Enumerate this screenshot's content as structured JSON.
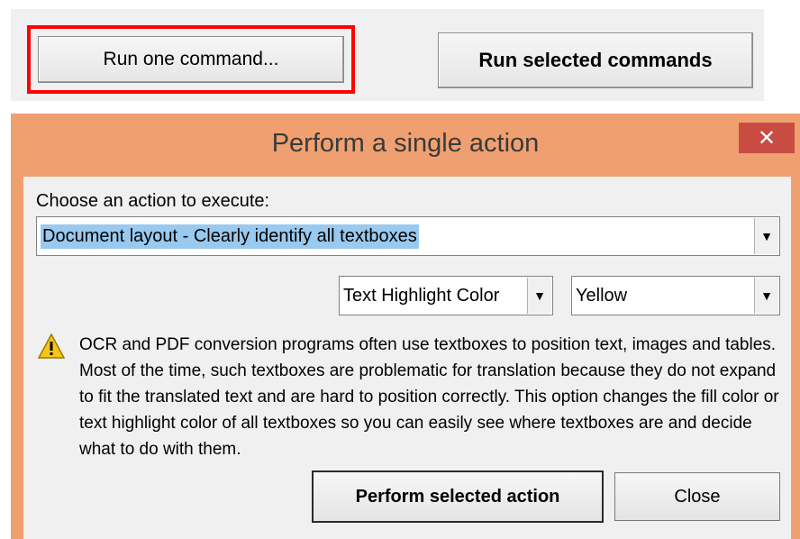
{
  "toolbar": {
    "run_one_label": "Run one command...",
    "run_selected_label": "Run selected commands"
  },
  "dialog": {
    "title": "Perform a single action",
    "close_glyph": "✕",
    "choose_label": "Choose an action to execute:",
    "action_selected": "Document layout - Clearly identify all textboxes",
    "highlight_selected": "Text Highlight Color",
    "color_selected": "Yellow",
    "description": "OCR and PDF conversion programs often use textboxes to position text, images and tables. Most of the time, such textboxes are problematic for translation because they do not expand to fit the translated text and are hard to position correctly. This option changes the fill color or text highlight color of all textboxes so you can easily see where textboxes are and decide what to do with them.",
    "perform_label": "Perform selected action",
    "close_label": "Close",
    "dropdown_arrow": "▼",
    "warning_icon": "warning-icon"
  },
  "colors": {
    "dialog_frame": "#f0a070",
    "close_button": "#c84c42",
    "selection": "#99c9ef",
    "focus_outline": "#ff0000"
  }
}
